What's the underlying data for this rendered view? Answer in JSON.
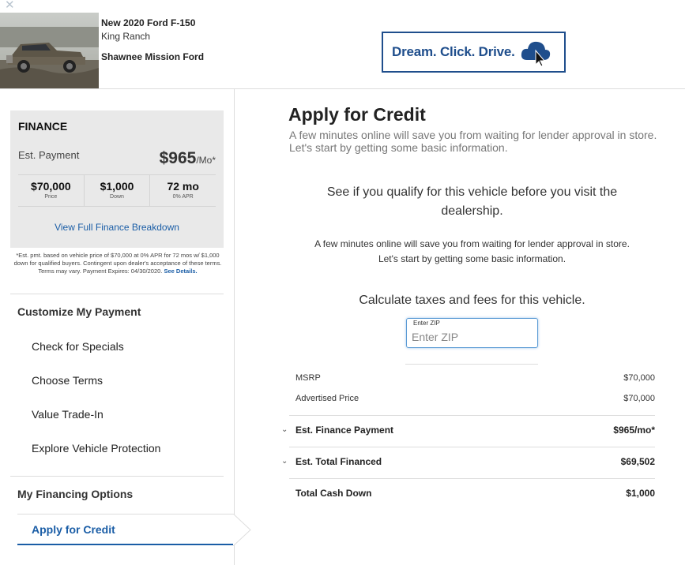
{
  "header": {
    "close_glyph": "✕",
    "vehicle_title": "New 2020 Ford F-150",
    "vehicle_trim": "King Ranch",
    "dealer_name": "Shawnee Mission Ford",
    "banner_text": "Dream. Click. Drive.",
    "banner_icon": "cloud-cursor-icon",
    "colors": {
      "brand_blue": "#1f4e8c",
      "link_blue": "#1a5da6"
    }
  },
  "finance": {
    "title": "FINANCE",
    "est_label": "Est. Payment",
    "est_amount": "$965",
    "est_suffix": "/Mo*",
    "stats": [
      {
        "value": "$70,000",
        "label": "Price"
      },
      {
        "value": "$1,000",
        "label": "Down"
      },
      {
        "value": "72 mo",
        "label": "0% APR"
      }
    ],
    "breakdown_link": "View Full Finance Breakdown",
    "disclaimer": "*Est. pmt. based on vehicle price of $70,000 at 0% APR for 72 mos w/ $1,000 down for qualified buyers. Contingent upon dealer's acceptance of these terms. Terms may vary. Payment Expires: 04/30/2020.",
    "see_details": "See Details."
  },
  "sidebar": {
    "customize_heading": "Customize My Payment",
    "items": [
      {
        "label": "Check for Specials"
      },
      {
        "label": "Choose Terms"
      },
      {
        "label": "Value Trade-In"
      },
      {
        "label": "Explore Vehicle Protection"
      }
    ],
    "financing_heading": "My Financing Options",
    "active_tab": "Apply for Credit"
  },
  "main": {
    "title": "Apply for Credit",
    "subtitle": "A few minutes online will save you from waiting for lender approval in store. Let's start by getting some basic information.",
    "qualify_heading": "See if you qualify for this vehicle before you visit the dealership.",
    "qualify_sub_line1": "A few minutes online will save you from waiting for lender approval in store.",
    "qualify_sub_line2": "Let's start by getting some basic information.",
    "calc_heading": "Calculate taxes and fees for this vehicle.",
    "zip": {
      "label": "Enter ZIP",
      "placeholder": "Enter ZIP",
      "value": ""
    },
    "msrp": {
      "label": "MSRP",
      "value": "$70,000"
    },
    "advertised": {
      "label": "Advertised Price",
      "value": "$70,000"
    },
    "finance_payment": {
      "label": "Est. Finance Payment",
      "value": "$965/mo*"
    },
    "total_financed": {
      "label": "Est. Total Financed",
      "value": "$69,502"
    },
    "cash_down": {
      "label": "Total Cash Down",
      "value": "$1,000"
    }
  }
}
